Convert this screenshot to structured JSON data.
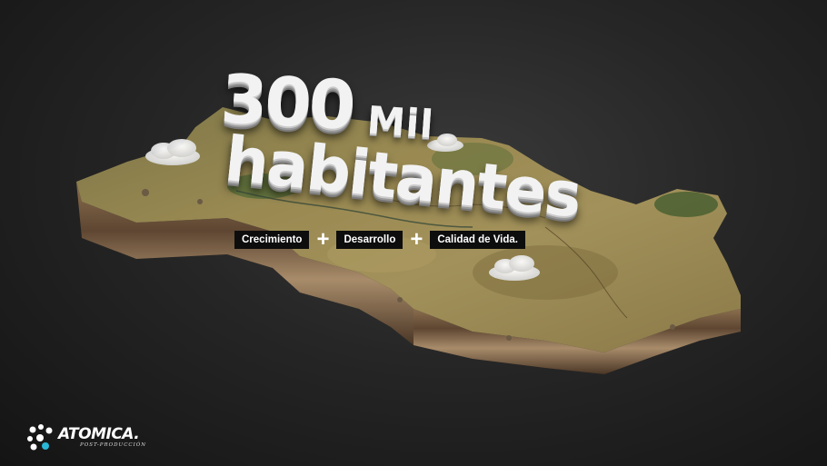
{
  "headline": {
    "number": "300",
    "unit": "Mil",
    "word": "habitantes"
  },
  "tags": [
    "Crecimiento",
    "Desarrollo",
    "Calidad de Vida."
  ],
  "separator": "+",
  "brand": {
    "name": "ATOMICA.",
    "subtitle": "POST-PRODUCCIÓN",
    "accent_color": "#29b6d6"
  },
  "colors": {
    "background": "#262626",
    "terrain": "#8a7a45",
    "tag_background": "#0d0d0d",
    "text": "#ffffff"
  }
}
